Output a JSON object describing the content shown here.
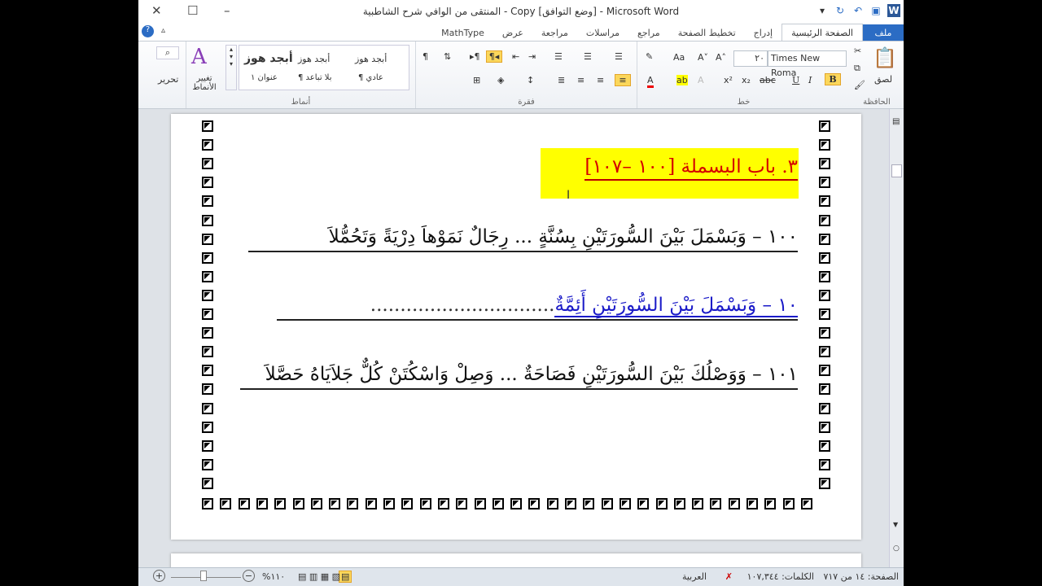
{
  "window": {
    "title": "المنتقى من الوافي شرح الشاطبية - Copy [وضع التوافق] - Microsoft Word"
  },
  "tabs": [
    "ملف",
    "الصفحة الرئيسية",
    "إدراج",
    "تخطيط الصفحة",
    "مراجع",
    "مراسلات",
    "مراجعة",
    "عرض",
    "MathType"
  ],
  "ribbon": {
    "clipboard": {
      "label": "الحافظة",
      "paste": "لصق"
    },
    "font": {
      "label": "خط",
      "name": "Times New Roma",
      "size": "٢٠",
      "bold": "B",
      "italic": "I",
      "underline": "U"
    },
    "paragraph": {
      "label": "فقرة"
    },
    "styles": {
      "label": "أنماط",
      "items": [
        {
          "sample": "أبجد هوز",
          "name": "¶ عادي"
        },
        {
          "sample": "أبجد هوز",
          "name": "¶ بلا تباعد"
        },
        {
          "sample": "أبجد هوز",
          "name": "عنوان ١"
        }
      ],
      "change": "تغيير الأنماط"
    },
    "editing": {
      "label": "تحرير"
    }
  },
  "document": {
    "heading": "٣. باب البسملة [١٠٠ –١٠٧]",
    "verse1": "١٠٠ – وَبَسْمَلَ بَيْنَ السُّورَتَيْنِ بِسُنَّةٍ ... رِجَالٌ نَمَوْهاَ دِرْيَةً وَتَحُمُّلاَ",
    "verse2": "١٠ – وَبَسْمَلَ بَيْنَ السُّورَتَيْنِ أَئِمَّةٌ",
    "verse2_dots": "...............................",
    "verse3": "١٠١ – وَوَصْلُكَ بَيْنَ السُّورَتَيْنِ فَصَاحَةٌ ... وَصِلْ وَاسْكُتَنْ كُلٌّ جَلاَيَاهُ حَصَّلاَ"
  },
  "status": {
    "page": "الصفحة: ١٤ من ٧١٧",
    "words": "الكلمات: ١٠٧,٣٤٤",
    "language": "العربية",
    "zoom": "%١١٠"
  },
  "colors": {
    "heading": "#d40000",
    "highlight": "#ffff00",
    "verse2": "#1b1bc8",
    "file_tab": "#2b6cc4"
  }
}
